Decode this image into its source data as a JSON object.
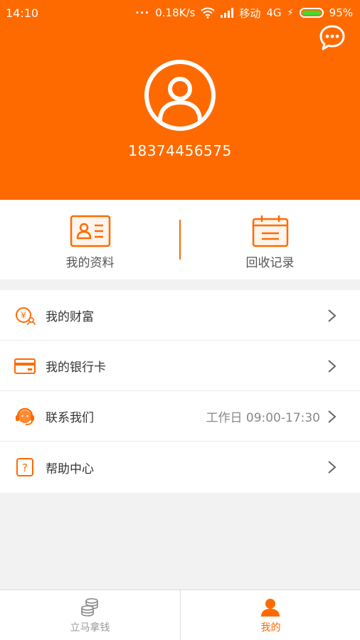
{
  "status_bar": {
    "time": "14:10",
    "speed": "0.18K/s",
    "carrier": "移动",
    "network": "4G",
    "battery": "95%"
  },
  "profile": {
    "phone": "18374456575"
  },
  "quick_actions": [
    {
      "label": "我的资料",
      "icon": "id-card-icon"
    },
    {
      "label": "回收记录",
      "icon": "calendar-icon"
    }
  ],
  "menu": [
    {
      "label": "我的财富",
      "icon": "wealth-icon",
      "hint": ""
    },
    {
      "label": "我的银行卡",
      "icon": "bank-card-icon",
      "hint": ""
    },
    {
      "label": "联系我们",
      "icon": "headset-icon",
      "hint": "工作日 09:00-17:30"
    },
    {
      "label": "帮助中心",
      "icon": "help-icon",
      "hint": ""
    }
  ],
  "bottom_nav": [
    {
      "label": "立马拿钱",
      "icon": "coins-icon",
      "active": false
    },
    {
      "label": "我的",
      "icon": "user-icon",
      "active": true
    }
  ],
  "colors": {
    "accent": "#ff6a00",
    "background": "#f2f2f2",
    "nav_inactive": "#999999"
  }
}
